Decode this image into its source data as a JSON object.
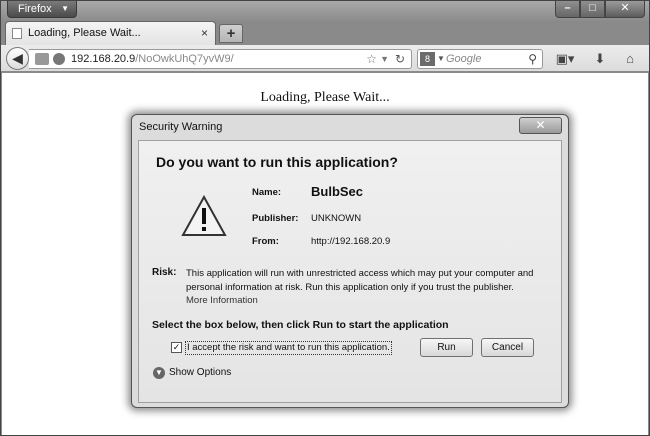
{
  "browser": {
    "app_button": "Firefox",
    "tab_title": "Loading, Please Wait...",
    "new_tab": "+",
    "url_host": "192.168.20.9",
    "url_path": "/NoOwkUhQ7yvW9/",
    "search_placeholder": "Google",
    "search_engine_icon": "8"
  },
  "page": {
    "loading_text": "Loading, Please Wait..."
  },
  "dialog": {
    "title": "Security Warning",
    "close_glyph": "✕",
    "question": "Do you want to run this application?",
    "name_label": "Name:",
    "name_value": "BulbSec",
    "publisher_label": "Publisher:",
    "publisher_value": "UNKNOWN",
    "from_label": "From:",
    "from_value": "http://192.168.20.9",
    "risk_label": "Risk:",
    "risk_text": "This application will run with unrestricted access which may put your computer and personal information at risk. Run this application only if you trust the publisher.",
    "more_info": "More Information",
    "instruction": "Select the box below, then click Run to start the application",
    "checkbox_label": "I accept the risk and want to run this application.",
    "checkbox_checked": "✓",
    "run_button": "Run",
    "cancel_button": "Cancel",
    "show_options": "Show Options"
  }
}
